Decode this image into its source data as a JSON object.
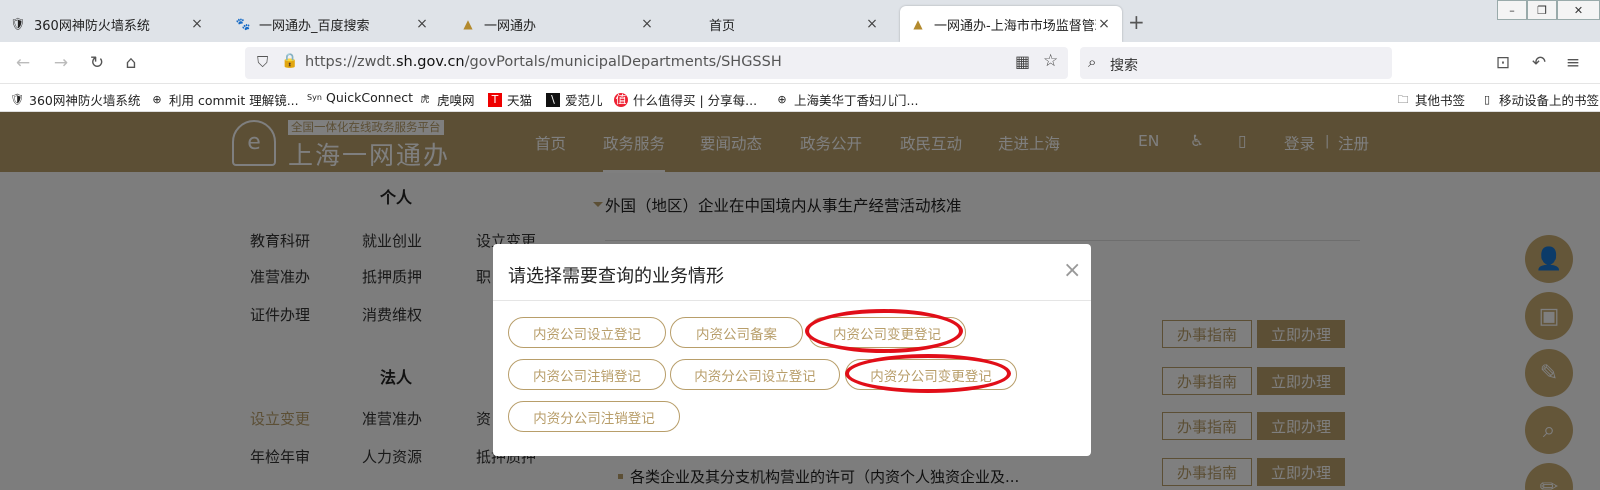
{
  "browser": {
    "tabs": [
      {
        "title": "360网神防火墙系统",
        "icon": "firewall-icon"
      },
      {
        "title": "一网通办_百度搜索",
        "icon": "baidu-paw-icon"
      },
      {
        "title": "一网通办",
        "icon": "bell-icon"
      },
      {
        "title": "首页",
        "icon": ""
      },
      {
        "title": "一网通办-上海市市场监督管理/",
        "icon": "bell-icon"
      }
    ],
    "url_prefix": "https://zwdt.",
    "url_domain": "sh.gov.cn",
    "url_path": "/govPortals/municipalDepartments/SHGSSH",
    "search_placeholder": "搜索",
    "bookmarks": [
      "360网神防火墙系统",
      "利用 commit 理解镜...",
      "QuickConnect",
      "虎嗅网",
      "天猫",
      "爱范儿",
      "什么值得买 | 分享每...",
      "上海美华丁香妇儿门..."
    ],
    "bookmarks_right": [
      "其他书签",
      "移动设备上的书签"
    ]
  },
  "site": {
    "logo_sub": "全国一体化在线政务服务平台",
    "logo_main": "上海一网通办",
    "nav": [
      "首页",
      "政务服务",
      "要闻动态",
      "政务公开",
      "政民互动",
      "走进上海"
    ],
    "lang": "EN",
    "login": "登录",
    "sep": "|",
    "register": "注册"
  },
  "left_menu": {
    "personal_title": "个人",
    "personal_items": [
      "教育科研",
      "就业创业",
      "设立变更",
      "准营准办",
      "抵押质押",
      "职",
      "证件办理",
      "消费维权"
    ],
    "legal_title": "法人",
    "legal_items": [
      "设立变更",
      "准营准办",
      "资",
      "年检年审",
      "人力资源",
      "抵押质押"
    ]
  },
  "main": {
    "section_title": "外国（地区）企业在中国境内从事生产经营活动核准",
    "last_service": "各类企业及其分支机构营业的许可（内资个人独资企业及...",
    "guide_label": "办事指南",
    "do_label": "立即办理"
  },
  "modal": {
    "title": "请选择需要查询的业务情形",
    "close": "×",
    "options": [
      "内资公司设立登记",
      "内资公司备案",
      "内资公司变更登记",
      "内资公司注销登记",
      "内资分公司设立登记",
      "内资分公司变更登记",
      "内资分公司注销登记"
    ]
  },
  "colors": {
    "brand_gold": "#b89e6a",
    "annotation_red": "#e10e18"
  }
}
